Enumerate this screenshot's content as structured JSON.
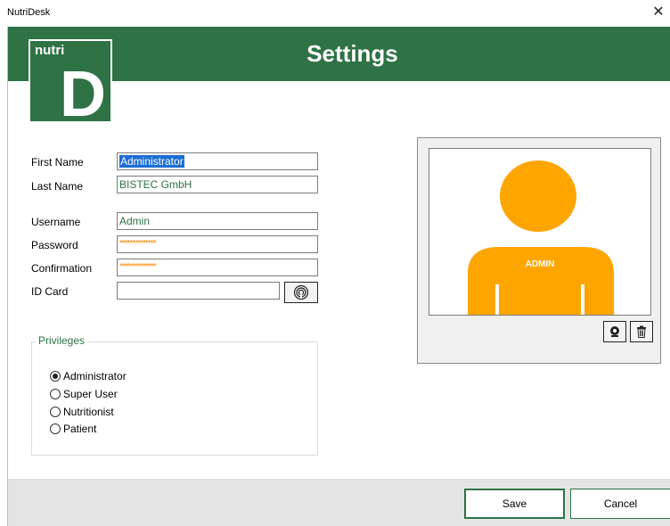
{
  "window": {
    "title": "NutriDesk",
    "close_glyph": "✕"
  },
  "header": {
    "title": "Settings",
    "bg_color": "#2e7245"
  },
  "logo": {
    "text": "nutri",
    "letter": "D"
  },
  "form": {
    "first_name": {
      "label": "First Name",
      "value": "Administrator"
    },
    "last_name": {
      "label": "Last Name",
      "value": "BISTEC GmbH"
    },
    "username": {
      "label": "Username",
      "value": "Admin"
    },
    "password": {
      "label": "Password",
      "value": "**************"
    },
    "confirmation": {
      "label": "Confirmation",
      "value": "**************"
    },
    "id_card": {
      "label": "ID Card",
      "value": "",
      "scan_icon": "fingerprint-icon"
    }
  },
  "privileges": {
    "title": "Privileges",
    "options": [
      {
        "label": "Administrator",
        "checked": true
      },
      {
        "label": "Super User",
        "checked": false
      },
      {
        "label": "Nutritionist",
        "checked": false
      },
      {
        "label": "Patient",
        "checked": false
      }
    ]
  },
  "photo": {
    "avatar_text": "ADMIN",
    "avatar_color": "#ffa500",
    "webcam_icon": "webcam-icon",
    "delete_icon": "trash-icon"
  },
  "buttons": {
    "save": "Save",
    "cancel": "Cancel"
  }
}
